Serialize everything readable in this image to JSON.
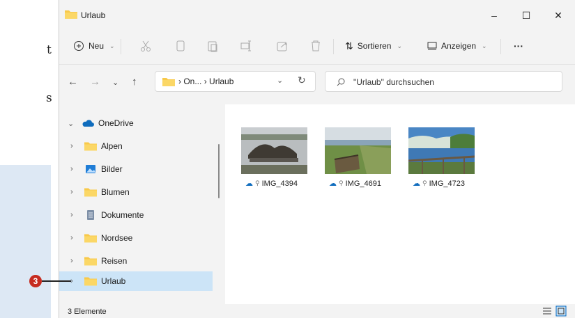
{
  "background": {
    "text_1": "t",
    "text_2": "s"
  },
  "annotation": {
    "number": "3",
    "color": "#c62b1f"
  },
  "window": {
    "title": "Urlaub",
    "controls": {
      "minimize": "–",
      "maximize": "☐",
      "close": "✕"
    }
  },
  "toolbar": {
    "new_label": "Neu",
    "sort_label": "Sortieren",
    "view_label": "Anzeigen",
    "more_label": "···"
  },
  "address": {
    "crumb_1": "On...",
    "crumb_2": "Urlaub",
    "sep": "›",
    "search_placeholder": "\"Urlaub\" durchsuchen"
  },
  "nav": {
    "root": "OneDrive",
    "items": [
      {
        "label": "Alpen",
        "icon": "folder-icon"
      },
      {
        "label": "Bilder",
        "icon": "pictures-icon"
      },
      {
        "label": "Blumen",
        "icon": "folder-icon"
      },
      {
        "label": "Dokumente",
        "icon": "documents-icon"
      },
      {
        "label": "Nordsee",
        "icon": "folder-icon"
      },
      {
        "label": "Reisen",
        "icon": "folder-icon"
      },
      {
        "label": "Urlaub",
        "icon": "folder-icon",
        "selected": true
      }
    ]
  },
  "files": [
    {
      "name": "IMG_4394"
    },
    {
      "name": "IMG_4691"
    },
    {
      "name": "IMG_4723"
    }
  ],
  "status": {
    "count": "3 Elemente"
  },
  "colors": {
    "accent": "#0067c0",
    "folder": "#f8c94a",
    "selected": "#cce4f7"
  }
}
